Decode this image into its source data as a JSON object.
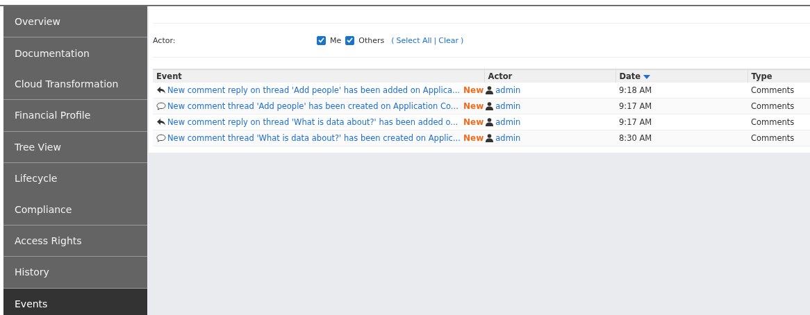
{
  "sidebar": {
    "groups": [
      {
        "items": [
          {
            "label": "Overview",
            "selected": false
          }
        ]
      },
      {
        "items": [
          {
            "label": "Documentation",
            "selected": false
          },
          {
            "label": "Cloud Transformation",
            "selected": false
          }
        ]
      },
      {
        "items": [
          {
            "label": "Financial Profile",
            "selected": false
          }
        ]
      },
      {
        "items": [
          {
            "label": "Tree View",
            "selected": false
          }
        ]
      },
      {
        "items": [
          {
            "label": "Lifecycle",
            "selected": false
          },
          {
            "label": "Compliance",
            "selected": false
          }
        ]
      },
      {
        "items": [
          {
            "label": "Access Rights",
            "selected": false
          }
        ]
      },
      {
        "items": [
          {
            "label": "History",
            "selected": false
          }
        ]
      },
      {
        "items": [
          {
            "label": "Events",
            "selected": true
          }
        ]
      }
    ]
  },
  "filter": {
    "label": "Actor:",
    "options": [
      {
        "label": "Me",
        "checked": true
      },
      {
        "label": "Others",
        "checked": true
      }
    ],
    "open_paren": "(",
    "select_all": "Select All",
    "separator": "|",
    "clear": "Clear",
    "close_paren": ")"
  },
  "table": {
    "columns": [
      {
        "label": "Event",
        "sorted": false
      },
      {
        "label": "Actor",
        "sorted": false
      },
      {
        "label": "Date",
        "sorted": true
      },
      {
        "label": "Type",
        "sorted": false
      }
    ],
    "rows": [
      {
        "kind": "reply",
        "event": "New comment reply on thread 'Add people' has been added on Applica...",
        "badge": "New",
        "actor": "admin",
        "date": "9:18 AM",
        "type": "Comments"
      },
      {
        "kind": "thread",
        "event": "New comment thread 'Add people' has been created on Application Co...",
        "badge": "New",
        "actor": "admin",
        "date": "9:17 AM",
        "type": "Comments"
      },
      {
        "kind": "reply",
        "event": "New comment reply on thread 'What is data about?' has been added o...",
        "badge": "New",
        "actor": "admin",
        "date": "9:17 AM",
        "type": "Comments"
      },
      {
        "kind": "thread",
        "event": "New comment thread 'What is data about?' has been created on Applic...",
        "badge": "New",
        "actor": "admin",
        "date": "8:30 AM",
        "type": "Comments"
      }
    ]
  }
}
